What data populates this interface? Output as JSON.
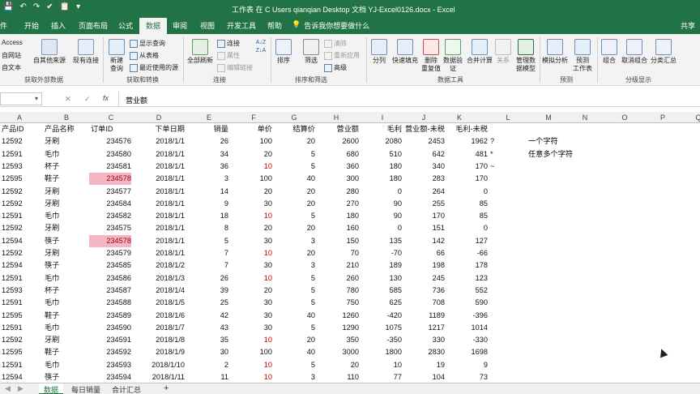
{
  "window": {
    "qat": [
      "💾",
      "↶",
      "↷",
      "✔",
      "📋",
      "▾"
    ],
    "title": "工作表 在 C  Users qianqian Desktop 文档 YJ-Excel0126.docx  -  Excel"
  },
  "tabs": [
    "件",
    "开始",
    "插入",
    "页面布局",
    "公式",
    "数据",
    "审阅",
    "视图",
    "开发工具",
    "帮助"
  ],
  "active_tab": "数据",
  "tellme": "告诉我你想要做什么",
  "share": "共享",
  "ribbon": {
    "ext_access": "Access",
    "ext_web": "自网站",
    "ext_text": "自文本",
    "ext_other": "自其他来源",
    "ext_existing": "现有连接",
    "ext_group": "获取外部数据",
    "new_query": "新建\n查询",
    "show_query": "显示查询",
    "from_table": "从表格",
    "recent_source": "最近使用的源",
    "get_group": "获取和转换",
    "refresh_all": "全部刷新",
    "connections": "连接",
    "properties": "属性",
    "edit_links": "编辑链接",
    "conn_group": "连接",
    "sort": "排序",
    "filter": "筛选",
    "clear": "清除",
    "reapply": "重新应用",
    "advanced": "高级",
    "sort_group": "排序和筛选",
    "split": "分列",
    "flash_fill": "快速填充",
    "remove_dup": "删除\n重复值",
    "validate": "数据验\n证",
    "consolidate": "合并计算",
    "relation": "关系",
    "data_model": "管理数\n据模型",
    "tools_group": "数据工具",
    "what_if": "模拟分析",
    "forecast": "预测\n工作表",
    "forecast_group": "预测",
    "group": "组合",
    "ungroup": "取消组合",
    "subtotal": "分类汇总",
    "outline_group": "分级显示"
  },
  "formula_bar": {
    "cancel": "✕",
    "enter": "✓",
    "fx": "fx",
    "value": "营业额"
  },
  "columns": [
    "A",
    "B",
    "C",
    "D",
    "E",
    "F",
    "G",
    "H",
    "I",
    "J",
    "K",
    "L",
    "M",
    "N",
    "O",
    "P",
    "Q"
  ],
  "headers": [
    "产品ID",
    "产品名称",
    "订单ID",
    "下单日期",
    "销量",
    "单价",
    "结算价",
    "营业额",
    "毛利",
    "营业额-未税",
    "毛利-未税"
  ],
  "notes": {
    "m1": "一个字符",
    "m2": "任意多个字符"
  },
  "rows": [
    [
      "12592",
      "牙刷",
      "234576",
      "2018/1/1",
      "26",
      "100",
      "20",
      "2600",
      "2080",
      "2453",
      "1962",
      "?"
    ],
    [
      "12591",
      "毛巾",
      "234580",
      "2018/1/1",
      "34",
      "20",
      "5",
      "680",
      "510",
      "642",
      "481",
      "*"
    ],
    [
      "12593",
      "杯子",
      "234581",
      "2018/1/1",
      "36",
      "10",
      "5",
      "360",
      "180",
      "340",
      "170",
      "~"
    ],
    [
      "12595",
      "鞋子",
      "234578",
      "2018/1/1",
      "3",
      "100",
      "40",
      "300",
      "180",
      "283",
      "170",
      ""
    ],
    [
      "12592",
      "牙刷",
      "234577",
      "2018/1/1",
      "14",
      "20",
      "20",
      "280",
      "0",
      "264",
      "0",
      ""
    ],
    [
      "12592",
      "牙刷",
      "234584",
      "2018/1/1",
      "9",
      "30",
      "20",
      "270",
      "90",
      "255",
      "85",
      ""
    ],
    [
      "12591",
      "毛巾",
      "234582",
      "2018/1/1",
      "18",
      "10",
      "5",
      "180",
      "90",
      "170",
      "85",
      ""
    ],
    [
      "12592",
      "牙刷",
      "234575",
      "2018/1/1",
      "8",
      "20",
      "20",
      "160",
      "0",
      "151",
      "0",
      ""
    ],
    [
      "12594",
      "筷子",
      "234578",
      "2018/1/1",
      "5",
      "30",
      "3",
      "150",
      "135",
      "142",
      "127",
      ""
    ],
    [
      "12592",
      "牙刷",
      "234579",
      "2018/1/1",
      "7",
      "10",
      "20",
      "70",
      "-70",
      "66",
      "-66",
      ""
    ],
    [
      "12594",
      "筷子",
      "234585",
      "2018/1/2",
      "7",
      "30",
      "3",
      "210",
      "189",
      "198",
      "178",
      ""
    ],
    [
      "12591",
      "毛巾",
      "234586",
      "2018/1/3",
      "26",
      "10",
      "5",
      "260",
      "130",
      "245",
      "123",
      ""
    ],
    [
      "12593",
      "杯子",
      "234587",
      "2018/1/4",
      "39",
      "20",
      "5",
      "780",
      "585",
      "736",
      "552",
      ""
    ],
    [
      "12591",
      "毛巾",
      "234588",
      "2018/1/5",
      "25",
      "30",
      "5",
      "750",
      "625",
      "708",
      "590",
      ""
    ],
    [
      "12595",
      "鞋子",
      "234589",
      "2018/1/6",
      "42",
      "30",
      "40",
      "1260",
      "-420",
      "1189",
      "-396",
      ""
    ],
    [
      "12591",
      "毛巾",
      "234590",
      "2018/1/7",
      "43",
      "30",
      "5",
      "1290",
      "1075",
      "1217",
      "1014",
      ""
    ],
    [
      "12592",
      "牙刷",
      "234591",
      "2018/1/8",
      "35",
      "10",
      "20",
      "350",
      "-350",
      "330",
      "-330",
      ""
    ],
    [
      "12595",
      "鞋子",
      "234592",
      "2018/1/9",
      "30",
      "100",
      "40",
      "3000",
      "1800",
      "2830",
      "1698",
      ""
    ],
    [
      "12591",
      "毛巾",
      "234593",
      "2018/1/10",
      "2",
      "10",
      "5",
      "20",
      "10",
      "19",
      "9",
      ""
    ],
    [
      "12594",
      "筷子",
      "234594",
      "2018/1/11",
      "11",
      "10",
      "3",
      "110",
      "77",
      "104",
      "73",
      ""
    ],
    [
      "12592",
      "牙刷",
      "234599",
      "2018/1/12",
      "20",
      "100",
      "20",
      "2000",
      "1600",
      "1887",
      "1509",
      ""
    ]
  ],
  "highlight_rows": [
    3,
    8
  ],
  "red_price_rows": [
    2,
    6,
    9,
    11,
    16,
    18,
    19
  ],
  "sheet_tabs": [
    "数据",
    "每日销量",
    "合计汇总"
  ],
  "add_sheet": "+",
  "colors": {
    "excel_green": "#217346",
    "dup_fill": "#f4b6c2",
    "dup_text": "#9c0006",
    "red_text": "#c00000"
  }
}
